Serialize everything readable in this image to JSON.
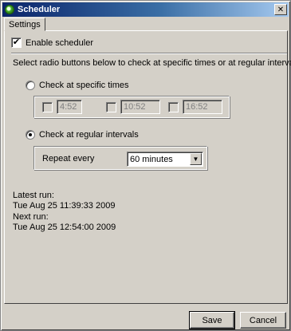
{
  "window": {
    "title": "Scheduler",
    "close_glyph": "✕"
  },
  "tabs": [
    {
      "label": "Settings"
    }
  ],
  "enable_scheduler": {
    "label": "Enable scheduler",
    "checked": true
  },
  "instructions": "Select radio buttons below to check at specific times or at regular intervals:",
  "specific_times": {
    "label": "Check at specific times",
    "selected": false,
    "times": [
      "4:52",
      "10:52",
      "16:52"
    ]
  },
  "regular_intervals": {
    "label": "Check at regular intervals",
    "selected": true,
    "repeat_label": "Repeat every",
    "repeat_value": "60 minutes"
  },
  "runs": {
    "latest_label": "Latest run:",
    "latest_value": "Tue Aug 25 11:39:33 2009",
    "next_label": "Next run:",
    "next_value": "Tue Aug 25 12:54:00 2009"
  },
  "buttons": {
    "save": "Save",
    "cancel": "Cancel"
  },
  "check_glyph": "✔",
  "dropdown_glyph": "▼"
}
